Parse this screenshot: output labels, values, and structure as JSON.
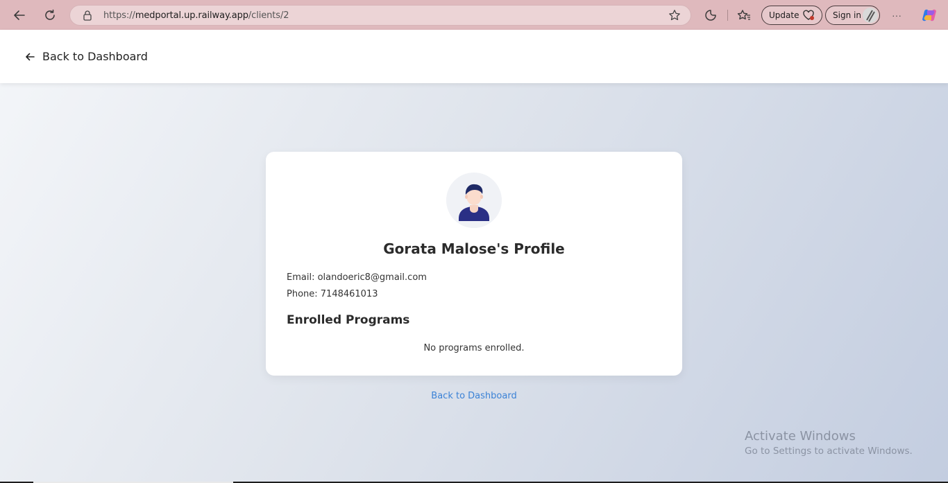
{
  "browser": {
    "url_proto": "https://",
    "url_host": "medportal.up.railway.app",
    "url_path": "/clients/2",
    "update_label": "Update",
    "signin_label": "Sign in",
    "more_label": "···"
  },
  "header": {
    "back_label": "Back to Dashboard"
  },
  "profile": {
    "title": "Gorata Malose's Profile",
    "email_line": "Email: olandoeric8@gmail.com",
    "phone_line": "Phone: 7148461013",
    "programs_heading": "Enrolled Programs",
    "programs_empty": "No programs enrolled."
  },
  "footer": {
    "back_link": "Back to Dashboard"
  },
  "watermark": {
    "title": "Activate Windows",
    "subtitle": "Go to Settings to activate Windows."
  },
  "colors": {
    "chrome": "#dfb9bd",
    "link": "#3b82d6",
    "avatar_shirt": "#2a2f85"
  }
}
